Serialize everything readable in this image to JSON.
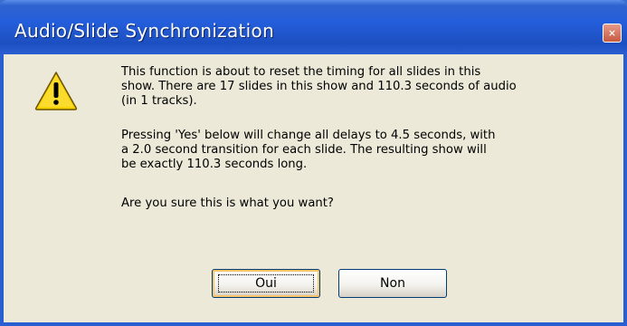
{
  "dialog": {
    "title": "Audio/Slide Synchronization",
    "icon": "warning-icon",
    "message": {
      "paragraph1": "This function is about to reset the timing for all slides in this\nshow.  There are 17 slides in this show and 110.3 seconds of audio\n(in 1 tracks).",
      "paragraph2": "Pressing 'Yes' below will change all delays to 4.5 seconds, with\na 2.0 second transition for each slide.  The resulting show will\nbe exactly 110.3 seconds long.",
      "paragraph3": "Are you sure this is what you want?"
    },
    "buttons": {
      "yes_label": "Oui",
      "no_label": "Non"
    }
  },
  "colors": {
    "titlebar": "#245edb",
    "client_background": "#ece9d8",
    "close_button": "#c75a3f",
    "warning_yellow": "#f6d100"
  }
}
